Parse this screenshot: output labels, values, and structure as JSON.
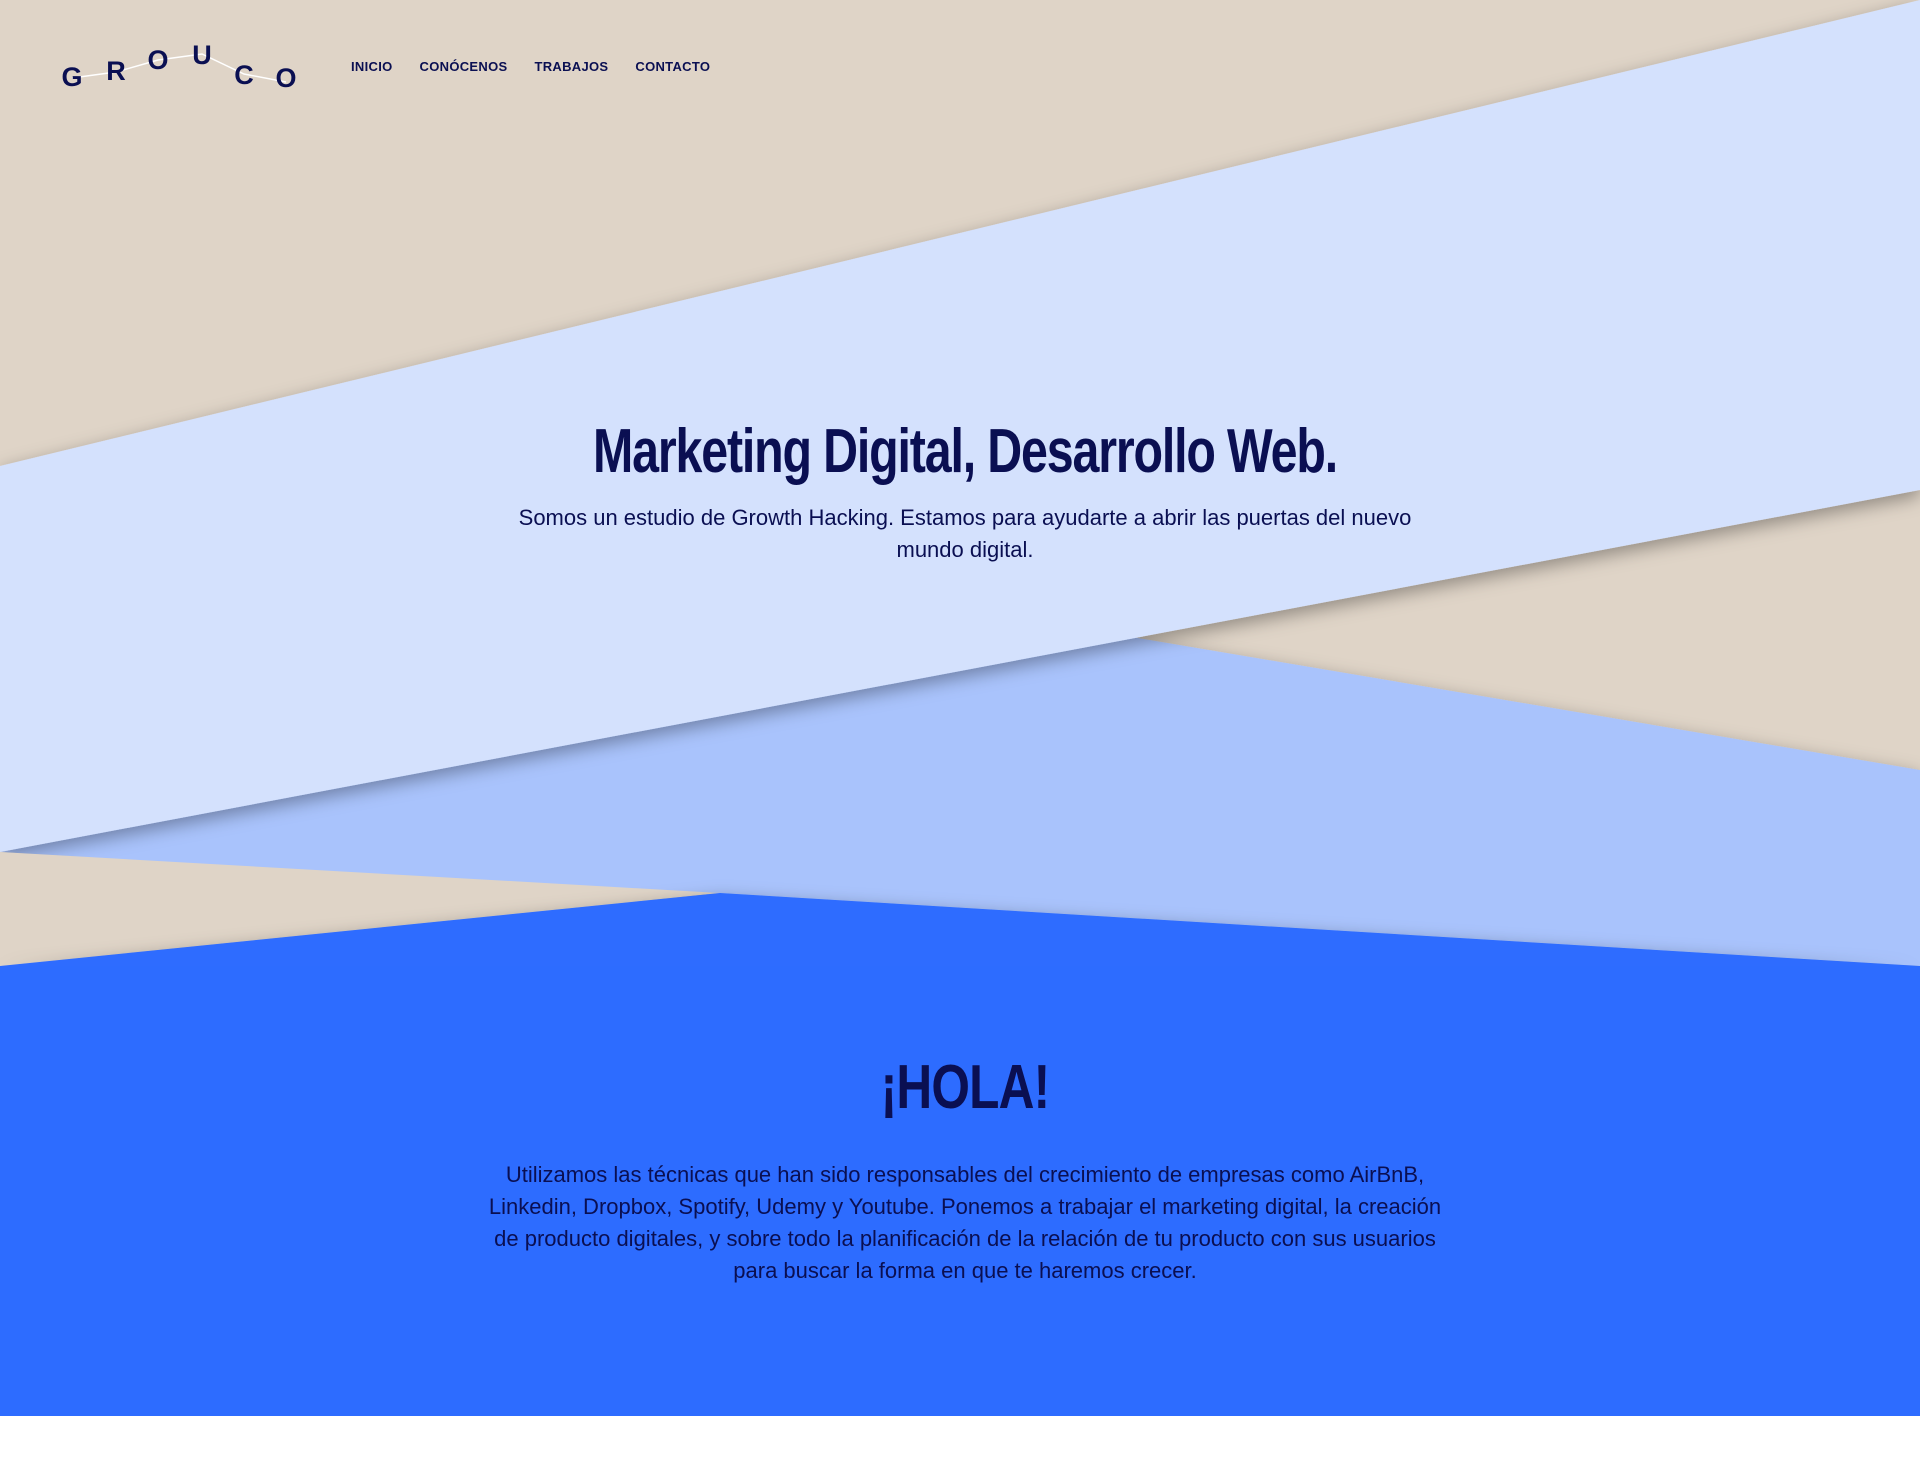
{
  "brand": {
    "logo_letters": [
      "G",
      "R",
      "O",
      "U",
      "C",
      "O"
    ],
    "logo_name": "GROUCO"
  },
  "nav": {
    "items": [
      {
        "label": "INICIO"
      },
      {
        "label": "CONÓCENOS"
      },
      {
        "label": "TRABAJOS"
      },
      {
        "label": "CONTACTO"
      }
    ]
  },
  "hero": {
    "title": "Marketing Digital, Desarrollo Web.",
    "subtitle": "Somos un estudio de Growth Hacking. Estamos para ayudarte a abrir las puertas del nuevo mundo digital."
  },
  "intro": {
    "title": "¡HOLA!",
    "text": "Utilizamos las técnicas que han sido responsables del crecimiento de empresas como AirBnB, Linkedin, Dropbox, Spotify, Udemy y Youtube. Ponemos a trabajar el marketing digital, la creación de producto digitales, y sobre todo la planificación de la relación de tu producto con sus usuarios para buscar la forma en que te haremos crecer."
  },
  "colors": {
    "beige": "#dfd4c7",
    "light_blue": "#d4e1fd",
    "mid_blue": "#a9c3fc",
    "bright_blue": "#2d6cff",
    "navy": "#0a0f52",
    "white": "#ffffff"
  }
}
